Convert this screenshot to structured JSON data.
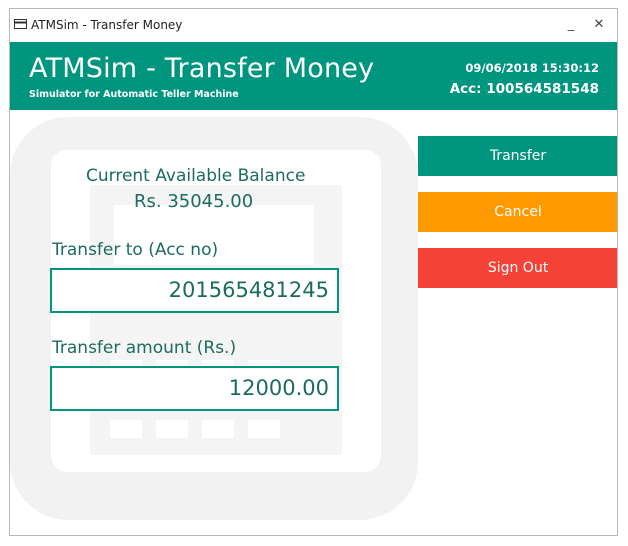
{
  "window": {
    "title": "ATMSim - Transfer Money",
    "minimize_glyph": "_",
    "close_glyph": "✕"
  },
  "header": {
    "title": "ATMSim - Transfer Money",
    "subtitle": "Simulator for Automatic Teller Machine",
    "datetime": "09/06/2018 15:30:12",
    "account": "Acc: 100564581548"
  },
  "balance": {
    "label": "Current Available Balance",
    "value": "Rs. 35045.00"
  },
  "form": {
    "transfer_to_label": "Transfer to (Acc no)",
    "transfer_to_value": "201565481245",
    "amount_label": "Transfer amount (Rs.)",
    "amount_value": "12000.00"
  },
  "buttons": {
    "transfer": "Transfer",
    "cancel": "Cancel",
    "sign_out": "Sign Out"
  },
  "colors": {
    "accent": "#00957f",
    "cancel": "#ff9900",
    "sign_out": "#f44336",
    "text": "#1c6b60"
  }
}
